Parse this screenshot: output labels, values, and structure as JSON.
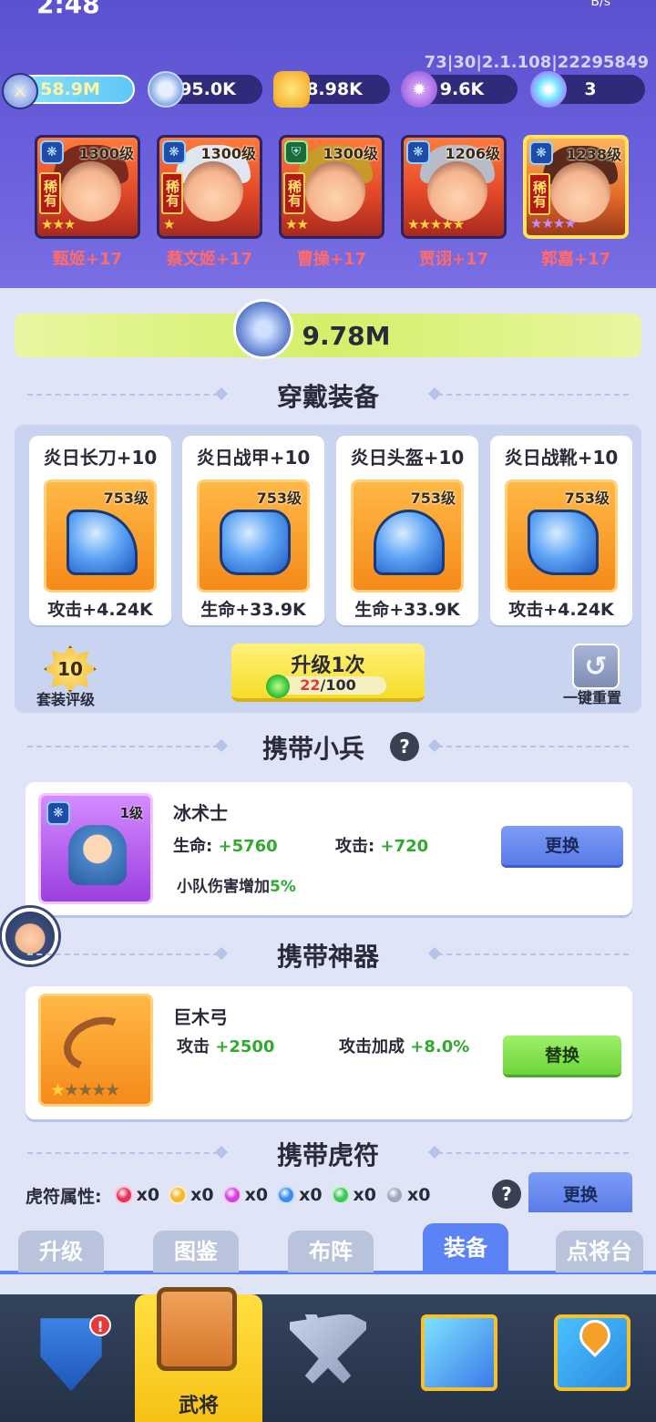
{
  "status": {
    "time": "2:48",
    "speed": "B/s"
  },
  "version": "73|30|2.1.108|22295849",
  "resources": {
    "power": "58.9M",
    "silver": "95.0K",
    "gold": "8.98K",
    "purple": "9.6K",
    "gem": "3"
  },
  "heroes": [
    {
      "name": "甄姬+17",
      "level": "1300级",
      "rare": "稀有",
      "stars": "★★★",
      "elem": "❋"
    },
    {
      "name": "蔡文姬+17",
      "level": "1300级",
      "rare": "稀有",
      "stars": "★",
      "elem": "❋"
    },
    {
      "name": "曹操+17",
      "level": "1300级",
      "rare": "稀有",
      "stars": "★★",
      "elem": "⛨"
    },
    {
      "name": "贾诩+17",
      "level": "1206级",
      "rare": "",
      "stars": "★★★★★",
      "elem": "❋"
    },
    {
      "name": "郭嘉+17",
      "level": "1238级",
      "rare": "稀有",
      "stars": "★★★★",
      "elem": "❋"
    }
  ],
  "power_total": "9.78M",
  "sections": {
    "equip": "穿戴装备",
    "soldier": "携带小兵",
    "artifact": "携带神器",
    "tiger": "携带虎符"
  },
  "equipment": [
    {
      "name": "炎日长刀+10",
      "level": "753级",
      "stat": "攻击+4.24K"
    },
    {
      "name": "炎日战甲+10",
      "level": "753级",
      "stat": "生命+33.9K"
    },
    {
      "name": "炎日头盔+10",
      "level": "753级",
      "stat": "生命+33.9K"
    },
    {
      "name": "炎日战靴+10",
      "level": "753级",
      "stat": "攻击+4.24K"
    }
  ],
  "set": {
    "value": "10",
    "label": "套装评级"
  },
  "upgrade": {
    "label": "升级1次",
    "current": "22",
    "total": "/100"
  },
  "reset_label": "一键重置",
  "soldier": {
    "name": "冰术士",
    "level": "1级",
    "hp_label": "生命:",
    "hp_value": "+5760",
    "atk_label": "攻击:",
    "atk_value": "+720",
    "bonus_label": "小队伤害增加",
    "bonus_value": "5%",
    "swap": "更换"
  },
  "artifact": {
    "name": "巨木弓",
    "atk_label": "攻击",
    "atk_value": "+2500",
    "bonus_label": "攻击加成",
    "bonus_value": "+8.0%",
    "swap": "替换",
    "stars": 1
  },
  "tiger": {
    "label": "虎符属性:",
    "orbs": [
      {
        "color": "#e8325a",
        "count": "x0"
      },
      {
        "color": "#f7b72a",
        "count": "x0"
      },
      {
        "color": "#d340e0",
        "count": "x0"
      },
      {
        "color": "#3a8cf0",
        "count": "x0"
      },
      {
        "color": "#3cc85a",
        "count": "x0"
      },
      {
        "color": "#9aa8c0",
        "count": "x0"
      }
    ],
    "swap": "更换"
  },
  "subtabs": [
    "升级",
    "图鉴",
    "布阵",
    "装备",
    "点将台"
  ],
  "active_subtab": "装备",
  "nav": {
    "active_label": "武将",
    "badge": "!"
  },
  "colors": {
    "header": "#6a5fdc",
    "accent_blue": "#5c83f5",
    "highlight_yellow": "#f7c216"
  }
}
